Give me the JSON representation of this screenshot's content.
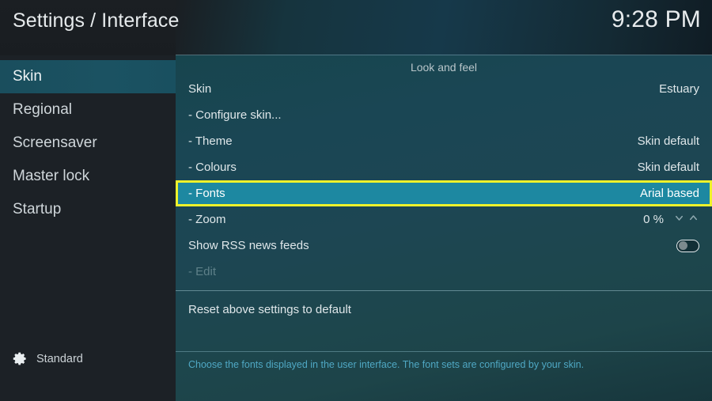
{
  "header": {
    "title": "Settings / Interface",
    "clock": "9:28 PM"
  },
  "sidebar": {
    "items": [
      {
        "label": "Skin",
        "selected": true
      },
      {
        "label": "Regional",
        "selected": false
      },
      {
        "label": "Screensaver",
        "selected": false
      },
      {
        "label": "Master lock",
        "selected": false
      },
      {
        "label": "Startup",
        "selected": false
      }
    ],
    "level": {
      "icon": "gear-icon",
      "label": "Standard"
    }
  },
  "main": {
    "category_title": "Look and feel",
    "rows": [
      {
        "label": "Skin",
        "value": "Estuary"
      },
      {
        "label": "- Configure skin...",
        "value": ""
      },
      {
        "label": "- Theme",
        "value": "Skin default"
      },
      {
        "label": "- Colours",
        "value": "Skin default"
      },
      {
        "label": "- Fonts",
        "value": "Arial based"
      },
      {
        "label": "- Zoom",
        "value": "0 %"
      },
      {
        "label": "Show RSS news feeds",
        "value": ""
      },
      {
        "label": "- Edit",
        "value": ""
      },
      {
        "label": "Reset above settings to default",
        "value": ""
      }
    ],
    "selected_row_index": 4,
    "zoom_spinner": {
      "down_icon": "chevron-down-icon",
      "up_icon": "chevron-up-icon"
    },
    "rss_toggle": {
      "state": "off",
      "icon": "toggle-off-icon"
    },
    "help_text": "Choose the fonts displayed in the user interface. The font sets are configured by your skin."
  },
  "colors": {
    "accent_teal": "#1d88a1",
    "focus_yellow": "#edf22b",
    "sidebar_bg": "#1c2126",
    "sidebar_selected": "#1a4e5d",
    "panel_bg": "#1d4653",
    "help_text": "#4fa8c4"
  }
}
